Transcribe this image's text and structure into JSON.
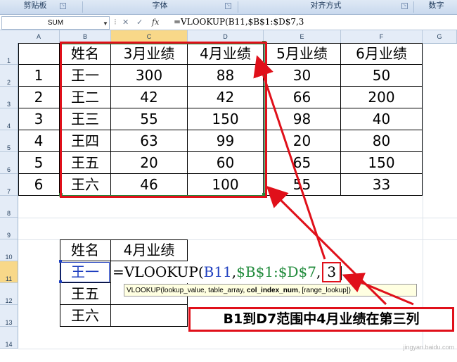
{
  "ribbon": {
    "groups": [
      "剪贴板",
      "字体",
      "对齐方式",
      "数字"
    ]
  },
  "formula_bar": {
    "name_box": "SUM",
    "buttons": {
      "cancel": "✕",
      "enter": "✓",
      "fx": "fx"
    },
    "formula": "=VLOOKUP(B11,$B$1:$D$7,3"
  },
  "columns": [
    "A",
    "B",
    "C",
    "D",
    "E",
    "F",
    "G"
  ],
  "rows": [
    "1",
    "2",
    "3",
    "4",
    "5",
    "6",
    "7",
    "8",
    "9",
    "10",
    "11",
    "12",
    "13",
    "14"
  ],
  "table": {
    "headers": [
      "姓名",
      "3月业绩",
      "4月业绩",
      "5月业绩",
      "6月业绩"
    ],
    "rows": [
      {
        "id": "1",
        "name": "王一",
        "m3": "300",
        "m4": "88",
        "m5": "30",
        "m6": "50"
      },
      {
        "id": "2",
        "name": "王二",
        "m3": "42",
        "m4": "42",
        "m5": "66",
        "m6": "200"
      },
      {
        "id": "3",
        "name": "王三",
        "m3": "55",
        "m4": "150",
        "m5": "98",
        "m6": "40"
      },
      {
        "id": "4",
        "name": "王四",
        "m3": "63",
        "m4": "99",
        "m5": "20",
        "m6": "80"
      },
      {
        "id": "5",
        "name": "王五",
        "m3": "20",
        "m4": "60",
        "m5": "65",
        "m6": "150"
      },
      {
        "id": "6",
        "name": "王六",
        "m3": "46",
        "m4": "100",
        "m5": "55",
        "m6": "33"
      }
    ]
  },
  "lookup": {
    "header_name": "姓名",
    "header_value": "4月业绩",
    "names": [
      "王一",
      "王五",
      "王六"
    ]
  },
  "edit": {
    "prefix": "=VLOOKUP(",
    "arg1": "B11",
    "sep1": ",",
    "arg2": "$B$1:$D$7",
    "sep2": ",",
    "arg3": "3"
  },
  "tooltip": {
    "fn": "VLOOKUP(",
    "p1": "lookup_value, table_array, ",
    "p_bold": "col_index_num",
    "p2": ", [range_lookup])"
  },
  "annotation": "B1到D7范围中4月业绩在第三列",
  "watermark": "jingyan.baidu.com",
  "colors": {
    "highlight_red": "#e0101a",
    "range_green": "#1f8a3a",
    "ref_blue": "#1f3fbf",
    "ref_green": "#1f8a3a"
  }
}
